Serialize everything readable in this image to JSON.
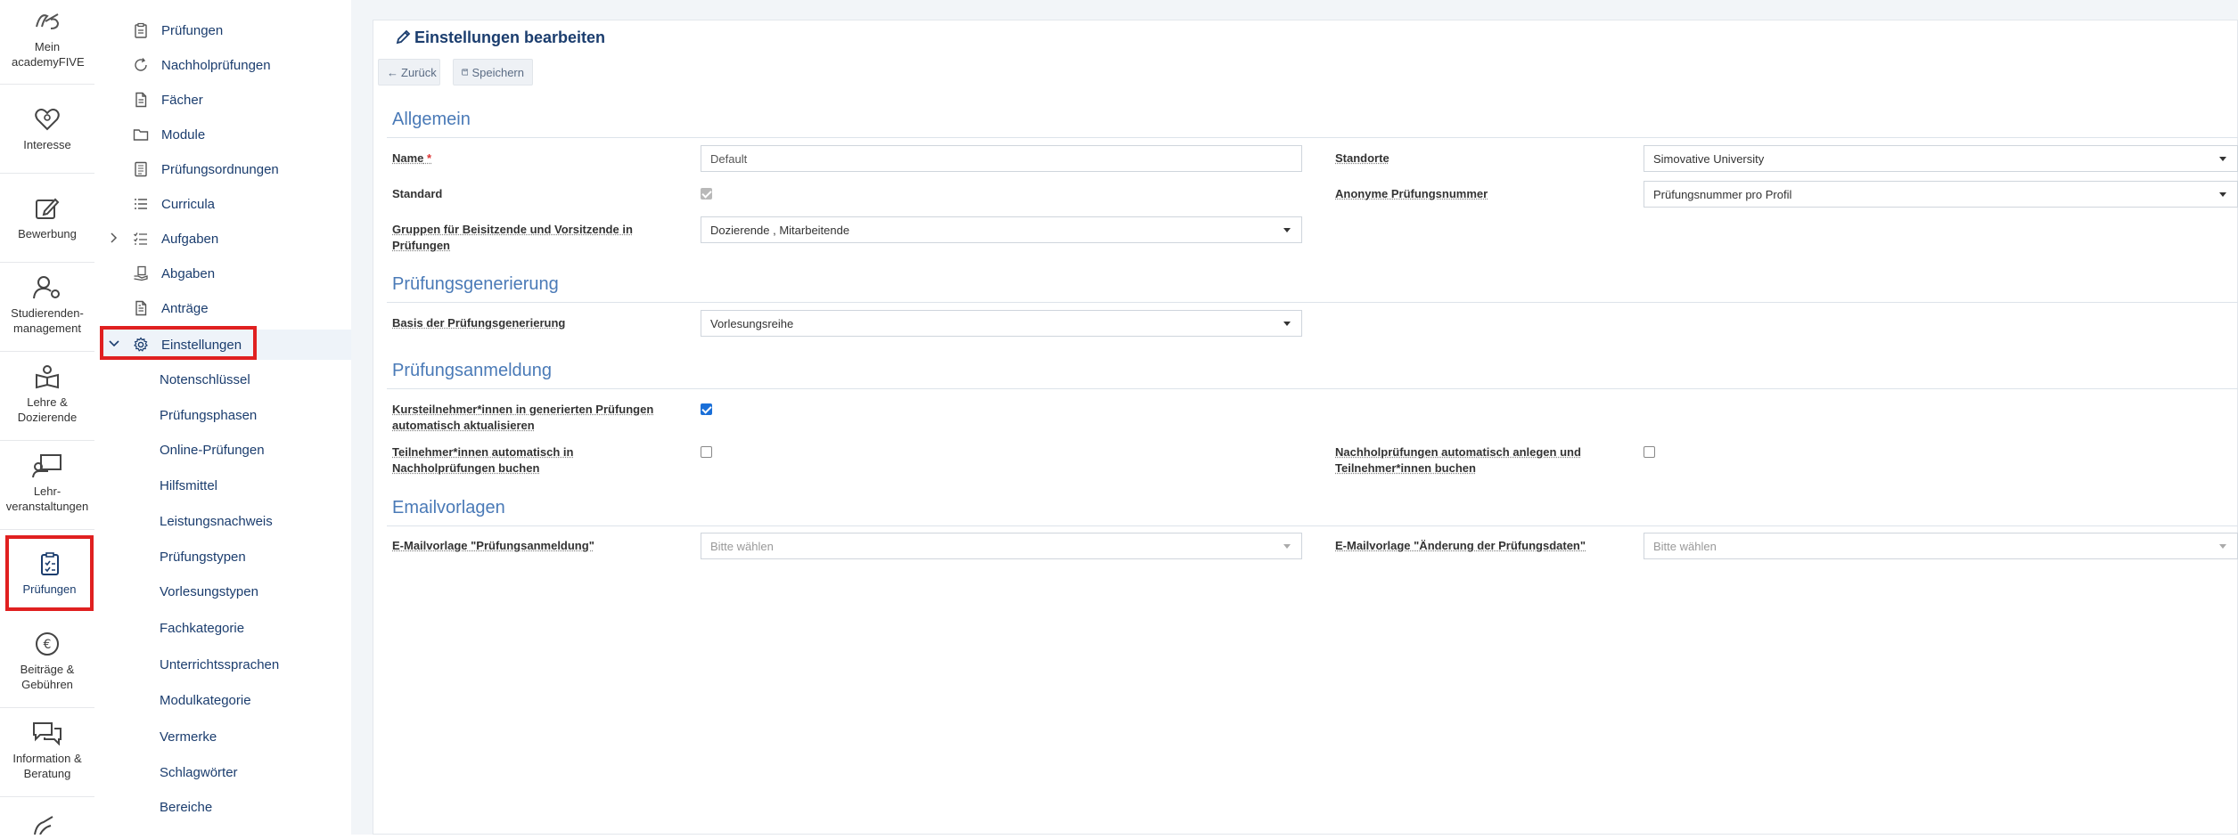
{
  "rail": [
    {
      "name": "academyfive-logo",
      "label": "Mein academyFIVE"
    },
    {
      "name": "heart-icon",
      "label": "Interesse"
    },
    {
      "name": "edit-icon",
      "label": "Bewerbung"
    },
    {
      "name": "student-settings-icon",
      "label": "Studierenden-management"
    },
    {
      "name": "book-person-icon",
      "label": "Lehre & Dozierende"
    },
    {
      "name": "presentation-icon",
      "label": "Lehr-veranstaltungen"
    },
    {
      "name": "clipboard-check-icon",
      "label": "Prüfungen"
    },
    {
      "name": "euro-icon",
      "label": "Beiträge & Gebühren"
    },
    {
      "name": "chat-icon",
      "label": "Information & Beratung"
    }
  ],
  "subnav": {
    "items": [
      {
        "label": "Prüfungen",
        "icon": "clipboard-icon"
      },
      {
        "label": "Nachholprüfungen",
        "icon": "refresh-icon"
      },
      {
        "label": "Fächer",
        "icon": "file-icon"
      },
      {
        "label": "Module",
        "icon": "folder-icon"
      },
      {
        "label": "Prüfungsordnungen",
        "icon": "document-list-icon"
      },
      {
        "label": "Curricula",
        "icon": "list-icon"
      },
      {
        "label": "Aufgaben",
        "icon": "task-list-icon"
      },
      {
        "label": "Abgaben",
        "icon": "hand-document-icon"
      },
      {
        "label": "Anträge",
        "icon": "file-text-icon"
      },
      {
        "label": "Einstellungen",
        "icon": "gear-icon"
      }
    ],
    "settings_children": [
      "Notenschlüssel",
      "Prüfungsphasen",
      "Online-Prüfungen",
      "Hilfsmittel",
      "Leistungsnachweis",
      "Prüfungstypen",
      "Vorlesungstypen",
      "Fachkategorie",
      "Unterrichtssprachen",
      "Modulkategorie",
      "Vermerke",
      "Schlagwörter",
      "Bereiche"
    ]
  },
  "page": {
    "title": "Einstellungen bearbeiten",
    "back_label": "Zurück",
    "save_label": "Speichern"
  },
  "sections": {
    "allgemein": "Allgemein",
    "generierung": "Prüfungsgenerierung",
    "anmeldung": "Prüfungsanmeldung",
    "email": "Emailvorlagen"
  },
  "fields": {
    "name_label": "Name",
    "name_required": "*",
    "name_value": "Default",
    "standorte_label": "Standorte",
    "standorte_value": "Simovative University",
    "standard_label": "Standard",
    "standard_checked": true,
    "anon_label": "Anonyme Prüfungsnummer",
    "anon_value": "Prüfungsnummer pro Profil",
    "gruppen_label": "Gruppen für Beisitzende und Vorsitzende in Prüfungen",
    "gruppen_value": "Dozierende , Mitarbeitende",
    "basis_label": "Basis der Prüfungsgenerierung",
    "basis_value": "Vorlesungsreihe",
    "kurs_label": "Kursteilnehmer*innen in generierten Prüfungen automatisch aktualisieren",
    "kurs_checked": true,
    "teiln_label": "Teilnehmer*innen automatisch in Nachholprüfungen buchen",
    "teiln_checked": false,
    "nachhol_label": "Nachholprüfungen automatisch anlegen und Teilnehmer*innen buchen",
    "nachhol_checked": false,
    "email_anmeldung_label": "E-Mailvorlage \"Prüfungsanmeldung\"",
    "email_anmeldung_value": "Bitte wählen",
    "email_aenderung_label": "E-Mailvorlage \"Änderung der Prüfungsdaten\"",
    "email_aenderung_value": "Bitte wählen"
  },
  "colors": {
    "accent": "#1b3d6e",
    "section": "#4a7ab7",
    "highlight": "#e02020",
    "checkbox": "#1a6fd8"
  }
}
